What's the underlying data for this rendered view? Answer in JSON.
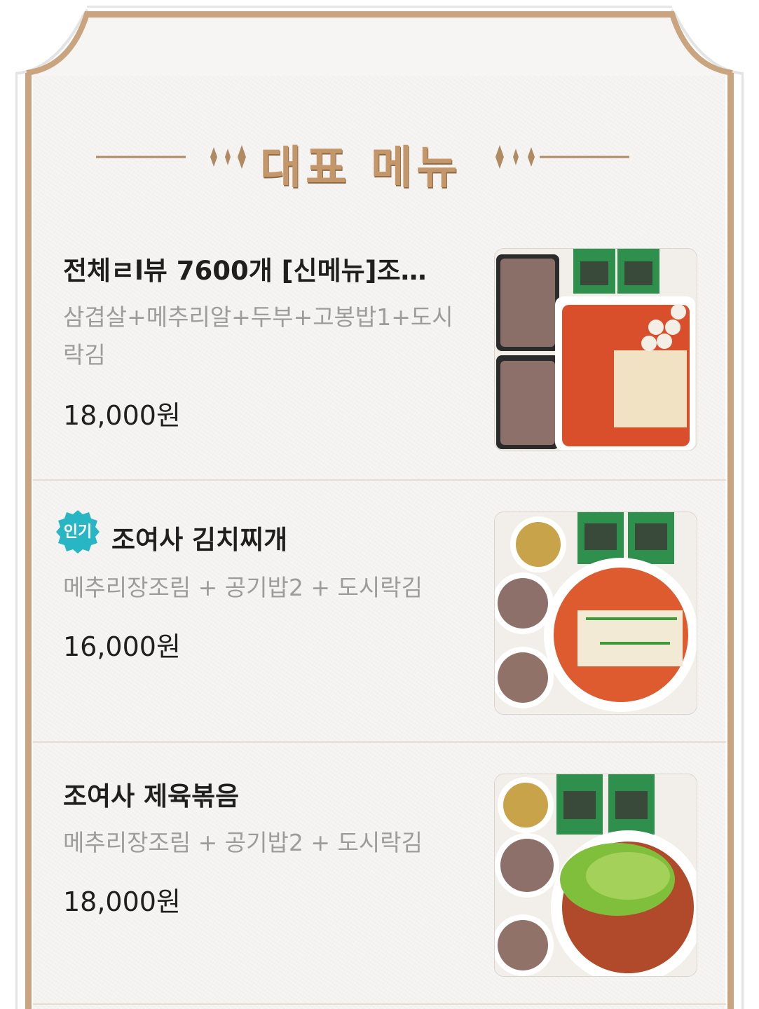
{
  "section": {
    "title": "대표 메뉴"
  },
  "colors": {
    "accent_gold": "#c4976b",
    "badge_teal": "#29b6c4",
    "text_dark": "#1f1f1f",
    "text_muted": "#9c9c9c"
  },
  "menu_items": [
    {
      "name": "전체ㄹl뷰 7600개 [신메뉴]조…",
      "description": "삼겹살+메추리알+두부+고봉밥1+도시락김",
      "price": "18,000원",
      "photo_icon": "food-photo"
    },
    {
      "badge": "인기",
      "name": "조여사 김치찌개",
      "description": "메추리장조림 + 공기밥2 + 도시락김",
      "price": "16,000원",
      "photo_icon": "food-photo"
    },
    {
      "name": "조여사 제육볶음",
      "description": "메추리장조림 + 공기밥2 + 도시락김",
      "price": "18,000원",
      "photo_icon": "food-photo"
    }
  ]
}
